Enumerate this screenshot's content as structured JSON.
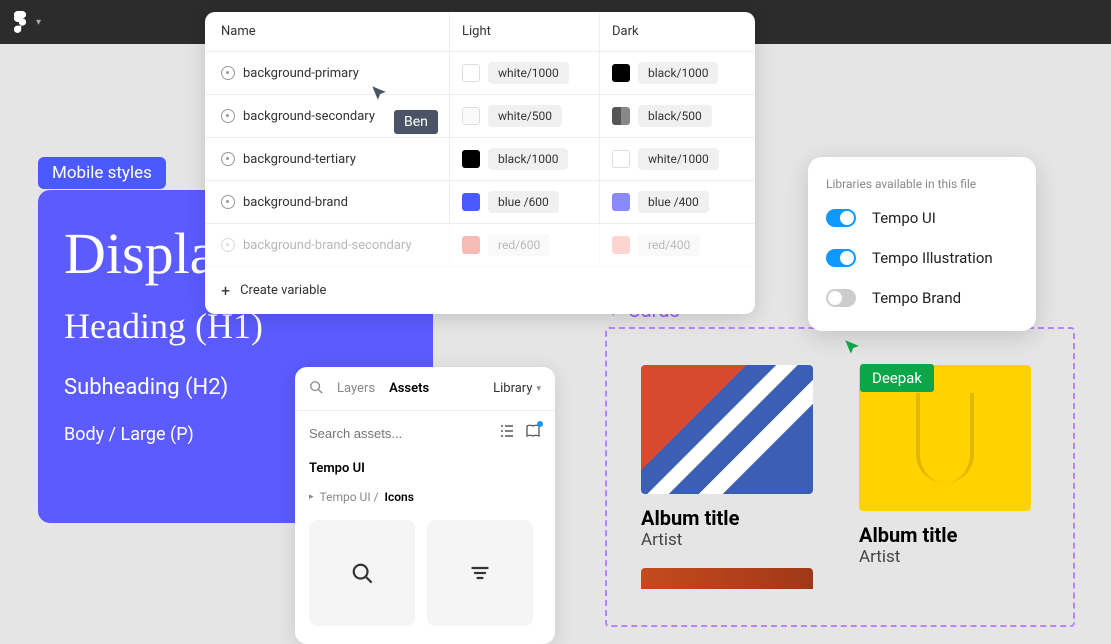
{
  "topbar": {
    "logo_name": "figma-logo"
  },
  "mobile_styles": {
    "label": "Mobile styles",
    "display": "Display",
    "h1": "Heading (H1)",
    "h2": "Subheading (H2)",
    "body": "Body / Large (P)"
  },
  "variables": {
    "headers": {
      "name": "Name",
      "light": "Light",
      "dark": "Dark"
    },
    "rows": [
      {
        "name": "background-primary",
        "light": "white/1000",
        "light_swatch": "sw-white",
        "dark": "black/1000",
        "dark_swatch": "sw-black"
      },
      {
        "name": "background-secondary",
        "light": "white/500",
        "light_swatch": "sw-white500",
        "dark": "black/500",
        "dark_swatch": "sw-black500"
      },
      {
        "name": "background-tertiary",
        "light": "black/1000",
        "light_swatch": "sw-black",
        "dark": "white/1000",
        "dark_swatch": "sw-white"
      },
      {
        "name": "background-brand",
        "light": "blue /600",
        "light_swatch": "sw-blue600",
        "dark": "blue /400",
        "dark_swatch": "sw-blue400"
      },
      {
        "name": "background-brand-secondary",
        "light": "red/600",
        "light_swatch": "sw-red600",
        "dark": "red/400",
        "dark_swatch": "sw-red400",
        "faded": true
      }
    ],
    "create": "Create variable"
  },
  "cursors": {
    "ben": "Ben",
    "deepak": "Deepak"
  },
  "assets": {
    "tab_layers": "Layers",
    "tab_assets": "Assets",
    "library_dd": "Library",
    "search_placeholder": "Search assets...",
    "section": "Tempo UI",
    "breadcrumb_parent": "Tempo UI /",
    "breadcrumb_current": "Icons"
  },
  "cards": {
    "label": "Cards",
    "items": [
      {
        "title": "Album title",
        "artist": "Artist"
      },
      {
        "title": "Album title",
        "artist": "Artist"
      }
    ]
  },
  "libraries": {
    "title": "Libraries available in this file",
    "items": [
      {
        "name": "Tempo UI",
        "on": true
      },
      {
        "name": "Tempo Illustration",
        "on": true
      },
      {
        "name": "Tempo Brand",
        "on": false
      }
    ]
  }
}
